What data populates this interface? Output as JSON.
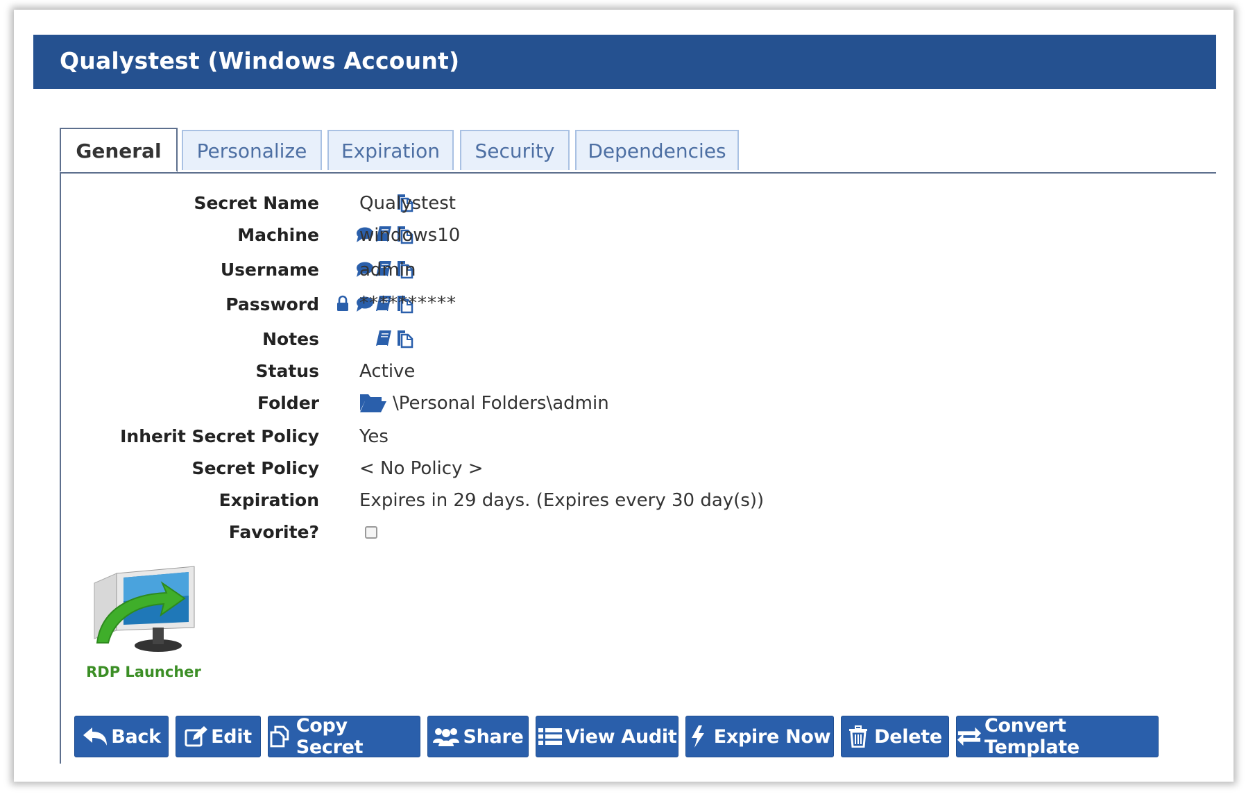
{
  "window": {
    "title": "Qualystest (Windows Account)"
  },
  "tabs": [
    {
      "label": "General",
      "active": true
    },
    {
      "label": "Personalize",
      "active": false
    },
    {
      "label": "Expiration",
      "active": false
    },
    {
      "label": "Security",
      "active": false
    },
    {
      "label": "Dependencies",
      "active": false
    }
  ],
  "fields": {
    "secret_name": {
      "label": "Secret Name",
      "value": "Qualystest",
      "icons": [
        "copy-icon"
      ]
    },
    "machine": {
      "label": "Machine",
      "value": "windows10",
      "icons": [
        "comment-icon",
        "book-icon",
        "copy-icon"
      ]
    },
    "username": {
      "label": "Username",
      "value": "admin",
      "icons": [
        "comment-icon",
        "book-icon",
        "copy-icon"
      ]
    },
    "password": {
      "label": "Password",
      "value": "**********",
      "icons": [
        "lock-icon",
        "comment-icon",
        "book-icon",
        "copy-icon"
      ]
    },
    "notes": {
      "label": "Notes",
      "value": "",
      "icons": [
        "book-icon",
        "copy-icon"
      ]
    },
    "status": {
      "label": "Status",
      "value": "Active"
    },
    "folder": {
      "label": "Folder",
      "value": "\\Personal Folders\\admin",
      "icon": "folder-open-icon"
    },
    "inherit_policy": {
      "label": "Inherit Secret Policy",
      "value": "Yes"
    },
    "secret_policy": {
      "label": "Secret Policy",
      "value": "< No Policy >"
    },
    "expiration": {
      "label": "Expiration",
      "value": "Expires in 29 days. (Expires every 30 day(s))"
    },
    "favorite": {
      "label": "Favorite?",
      "checked": false
    }
  },
  "launcher": {
    "label": "RDP Launcher",
    "icon": "rdp-launcher-icon"
  },
  "actions": {
    "back": "Back",
    "edit": "Edit",
    "copy_secret": "Copy Secret",
    "share": "Share",
    "view_audit": "View Audit",
    "expire_now": "Expire Now",
    "delete": "Delete",
    "convert_template": "Convert Template"
  },
  "colors": {
    "header_bg": "#255190",
    "button_bg": "#2a5fab",
    "tab_text": "#4d6fa3",
    "launcher_text": "#3b8e25",
    "icon_color": "#2a5fab"
  }
}
